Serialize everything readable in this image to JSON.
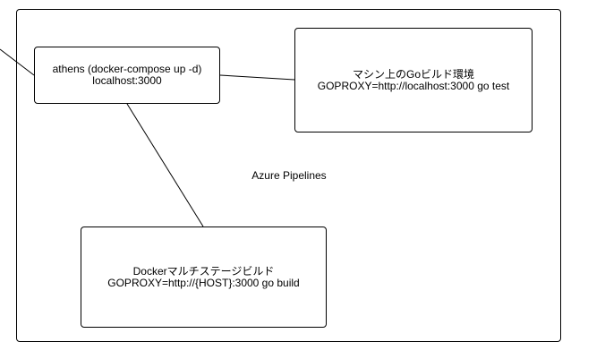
{
  "container": {
    "label": "Azure Pipelines"
  },
  "nodes": {
    "athens": {
      "line1": "athens (docker-compose up -d)",
      "line2": "localhost:3000"
    },
    "local_build": {
      "line1": "マシン上のGoビルド環境",
      "line2": "GOPROXY=http://localhost:3000 go test"
    },
    "docker_build": {
      "line1": "Dockerマルチステージビルド",
      "line2": "GOPROXY=http://{HOST}:3000 go build"
    }
  },
  "colors": {
    "stroke": "#000000",
    "background": "#ffffff"
  }
}
